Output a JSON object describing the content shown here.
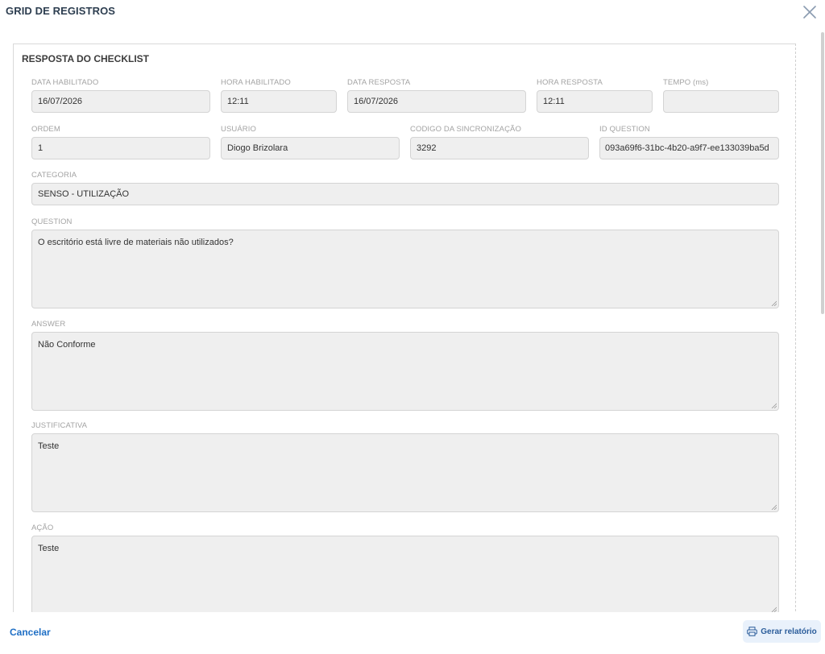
{
  "modal": {
    "title": "GRID DE REGISTROS"
  },
  "card": {
    "title": "RESPOSTA DO CHECKLIST"
  },
  "fields": {
    "data_habilitado": {
      "label": "DATA HABILITADO",
      "value": "16/07/2026"
    },
    "hora_habilitado": {
      "label": "HORA HABILITADO",
      "value": "12:11"
    },
    "data_resposta": {
      "label": "DATA RESPOSTA",
      "value": "16/07/2026"
    },
    "hora_resposta": {
      "label": "HORA RESPOSTA",
      "value": "12:11"
    },
    "tempo": {
      "label": "TEMPO (ms)",
      "value": ""
    },
    "ordem": {
      "label": "ORDEM",
      "value": "1"
    },
    "usuario": {
      "label": "USUÁRIO",
      "value": "Diogo Brizolara"
    },
    "codigo_sincronizacao": {
      "label": "CODIGO DA SINCRONIZAÇÃO",
      "value": "3292"
    },
    "id_question": {
      "label": "ID QUESTION",
      "value": "093a69f6-31bc-4b20-a9f7-ee133039ba5d"
    },
    "categoria": {
      "label": "CATEGORIA",
      "value": "SENSO - UTILIZAÇÃO"
    },
    "question": {
      "label": "QUESTION",
      "value": "O escritório está livre de materiais não utilizados?"
    },
    "answer": {
      "label": "ANSWER",
      "value": "Não Conforme"
    },
    "justificativa": {
      "label": "JUSTIFICATIVA",
      "value": "Teste"
    },
    "acao": {
      "label": "AÇÃO",
      "value": "Teste"
    }
  },
  "footer": {
    "cancel_label": "Cancelar",
    "report_label": "Gerar relatório"
  },
  "icons": {
    "close": "close-icon",
    "printer": "printer-icon"
  },
  "colors": {
    "accent": "#1f6fc5",
    "title": "#2d3e50",
    "input_bg": "#efefef"
  }
}
